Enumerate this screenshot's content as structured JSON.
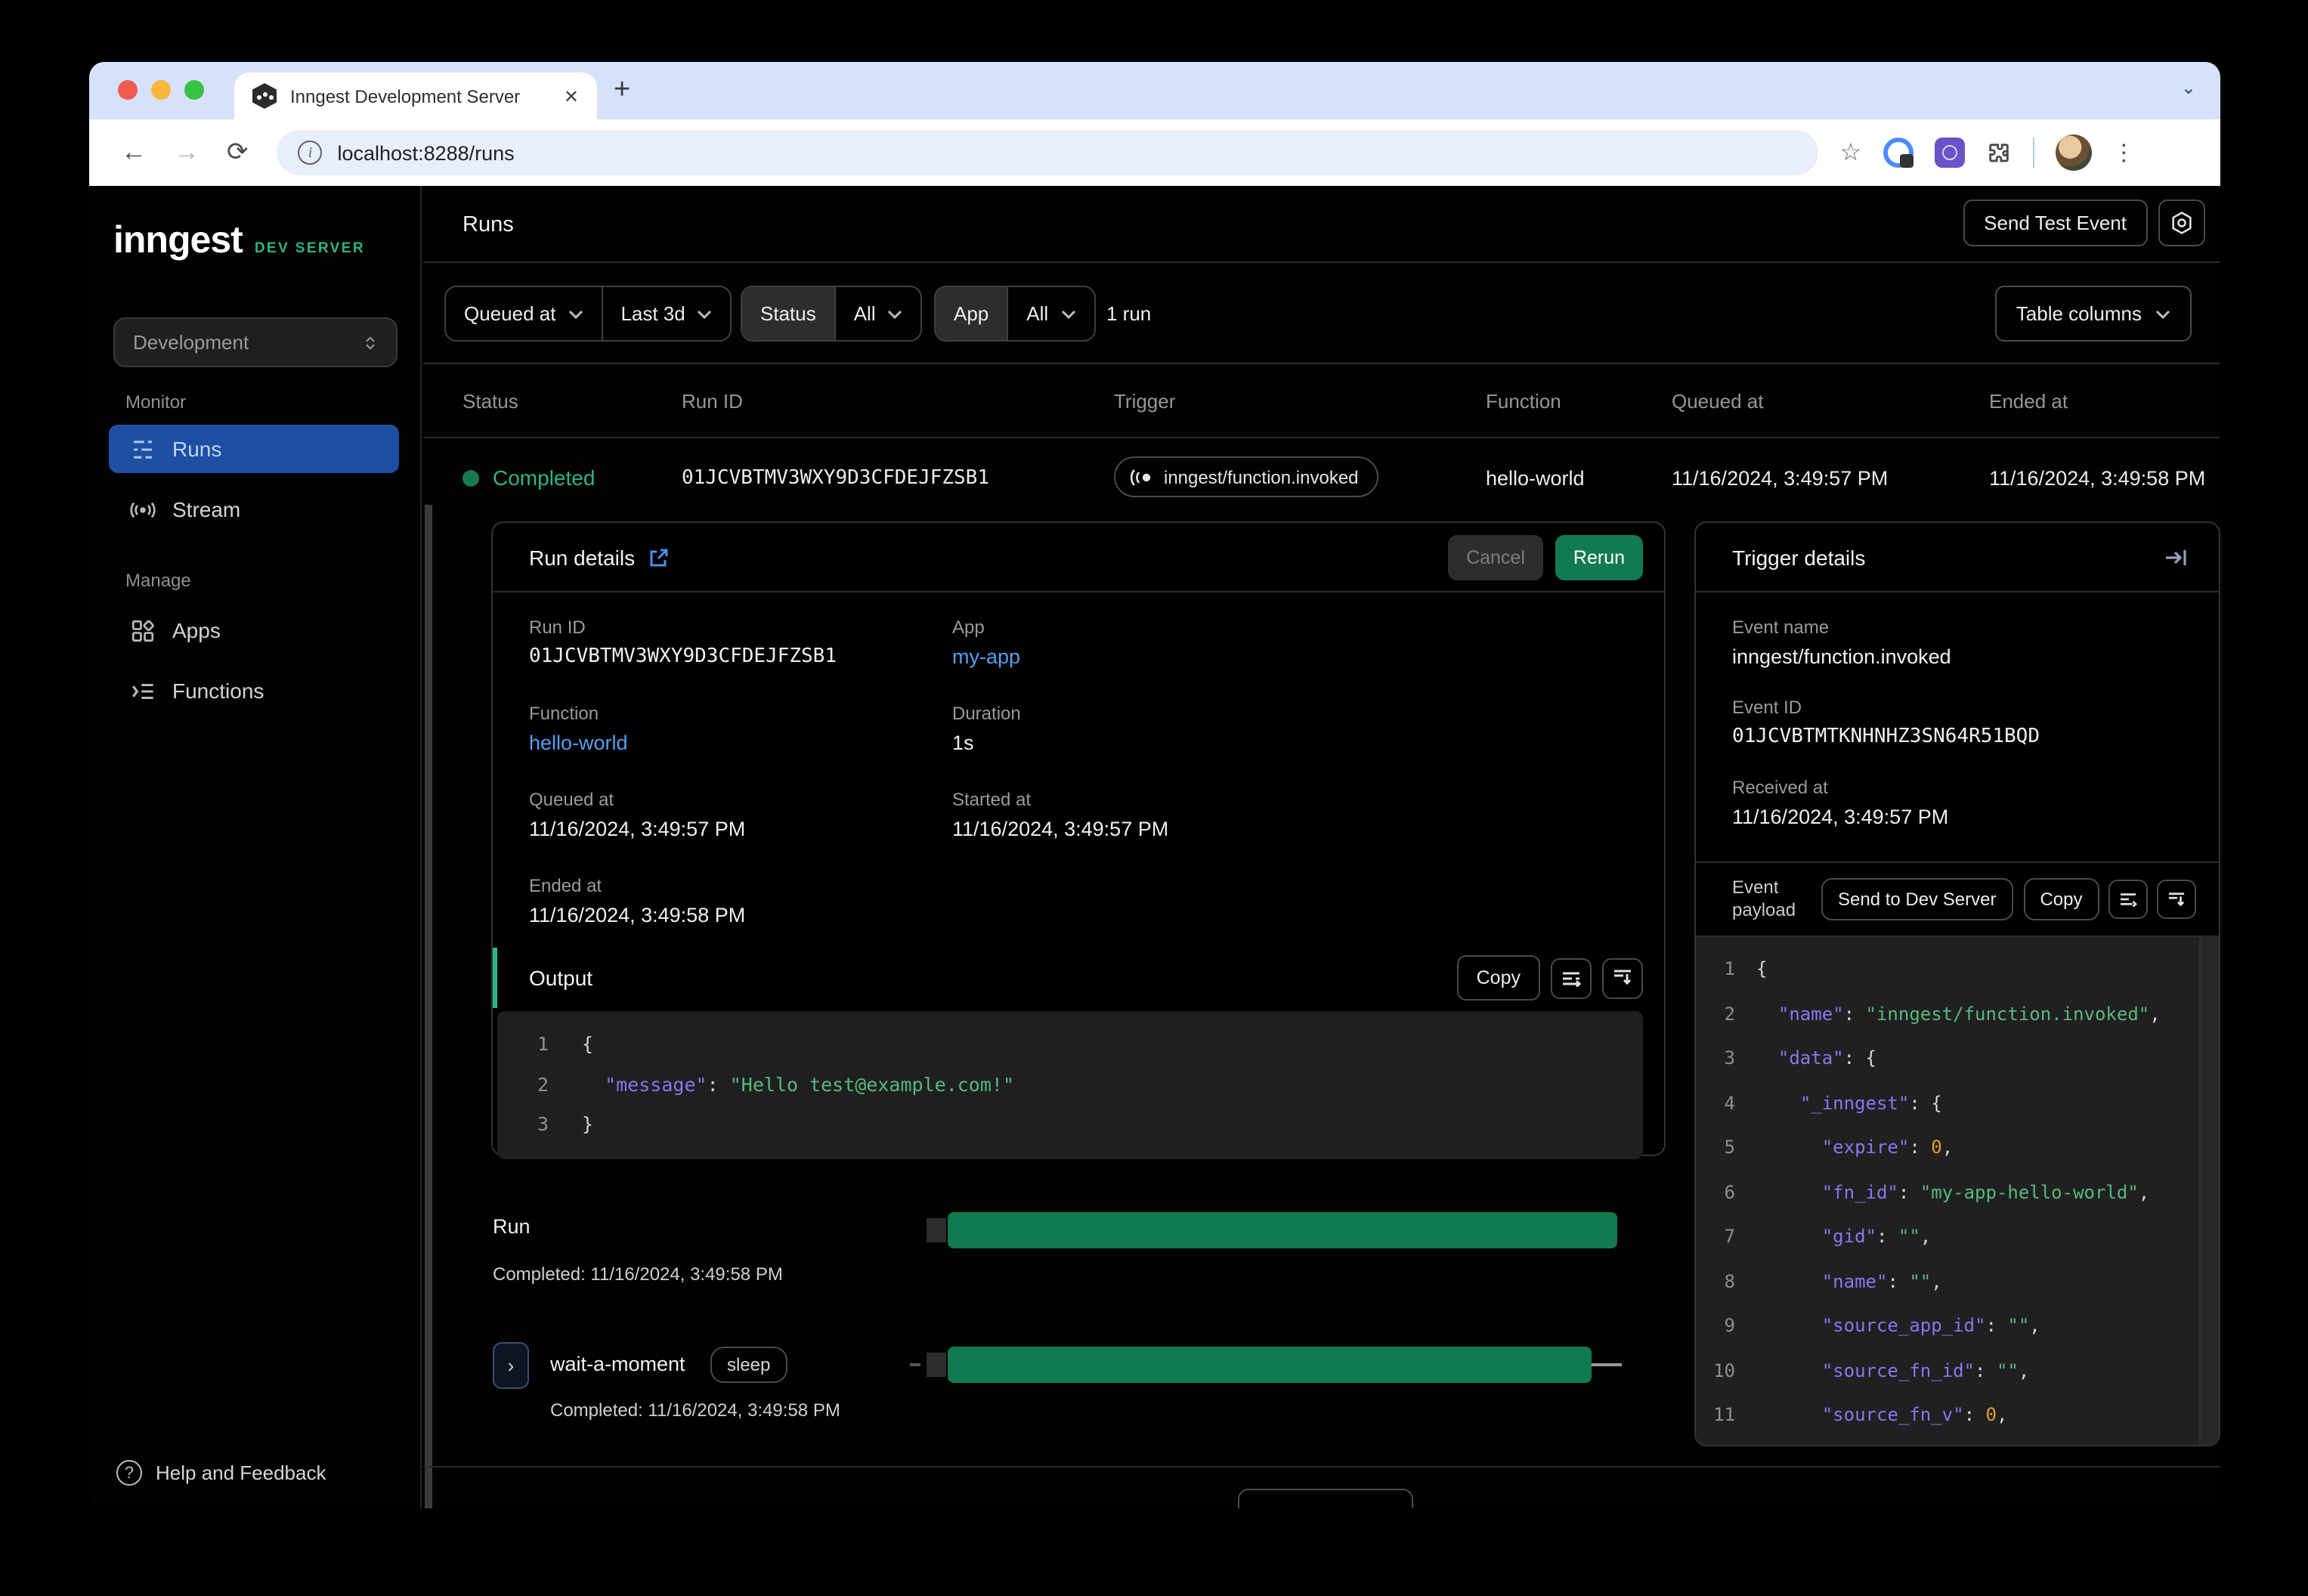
{
  "browser": {
    "tab_title": "Inngest Development Server",
    "close_tab": "✕",
    "new_tab": "+",
    "url": "localhost:8288/runs",
    "back": "←",
    "forward": "→",
    "reload": "⟳",
    "info": "i",
    "star": "☆",
    "kebab": "⋮",
    "strip_chevron": "⌄"
  },
  "sidebar": {
    "logo": "inngest",
    "env": "DEV SERVER",
    "workspace": "Development",
    "monitor_label": "Monitor",
    "manage_label": "Manage",
    "items": [
      {
        "label": "Runs"
      },
      {
        "label": "Stream"
      },
      {
        "label": "Apps"
      },
      {
        "label": "Functions"
      }
    ],
    "help": "Help and Feedback"
  },
  "header": {
    "title": "Runs",
    "send_test_event": "Send Test Event"
  },
  "filters": {
    "field": "Queued at",
    "range": "Last 3d",
    "status_label": "Status",
    "status_value": "All",
    "app_label": "App",
    "app_value": "All",
    "count": "1 run",
    "table_columns": "Table columns"
  },
  "table": {
    "columns": [
      "Status",
      "Run ID",
      "Trigger",
      "Function",
      "Queued at",
      "Ended at"
    ],
    "row": {
      "status": "Completed",
      "run_id": "01JCVBTMV3WXY9D3CFDEJFZSB1",
      "trigger": "inngest/function.invoked",
      "function": "hello-world",
      "queued_at": "11/16/2024, 3:49:57 PM",
      "ended_at": "11/16/2024, 3:49:58 PM"
    }
  },
  "run_details": {
    "title": "Run details",
    "cancel": "Cancel",
    "rerun": "Rerun",
    "fields": [
      {
        "label": "Run ID",
        "value": "01JCVBTMV3WXY9D3CFDEJFZSB1"
      },
      {
        "label": "App",
        "value": "my-app"
      },
      {
        "label": "Function",
        "value": "hello-world"
      },
      {
        "label": "Duration",
        "value": "1s"
      },
      {
        "label": "Queued at",
        "value": "11/16/2024, 3:49:57 PM"
      },
      {
        "label": "Started at",
        "value": "11/16/2024, 3:49:57 PM"
      },
      {
        "label": "Ended at",
        "value": "11/16/2024, 3:49:58 PM"
      }
    ],
    "output": {
      "title": "Output",
      "copy": "Copy",
      "lines": [
        {
          "n": "1",
          "tokens": [
            {
              "t": "p",
              "v": "{"
            }
          ]
        },
        {
          "n": "2",
          "tokens": [
            {
              "t": "p",
              "v": "  "
            },
            {
              "t": "k",
              "v": "\"message\""
            },
            {
              "t": "p",
              "v": ": "
            },
            {
              "t": "s",
              "v": "\"Hello test@example.com!\""
            }
          ]
        },
        {
          "n": "3",
          "tokens": [
            {
              "t": "p",
              "v": "}"
            }
          ]
        }
      ]
    }
  },
  "timeline": {
    "run_label": "Run",
    "run_completed": "Completed: 11/16/2024, 3:49:58 PM",
    "step_name": "wait-a-moment",
    "step_kind": "sleep",
    "step_completed": "Completed: 11/16/2024, 3:49:58 PM",
    "expand": "›"
  },
  "trigger_details": {
    "title": "Trigger details",
    "fields": [
      {
        "label": "Event name",
        "value": "inngest/function.invoked"
      },
      {
        "label": "Event ID",
        "value": "01JCVBTMTKNHNHZ3SN64R51BQD"
      },
      {
        "label": "Received at",
        "value": "11/16/2024, 3:49:57 PM"
      }
    ],
    "payload": {
      "label_line1": "Event",
      "label_line2": "payload",
      "send": "Send to Dev Server",
      "copy": "Copy",
      "lines": [
        {
          "n": "1",
          "tokens": [
            {
              "t": "p",
              "v": "{"
            }
          ]
        },
        {
          "n": "2",
          "tokens": [
            {
              "t": "p",
              "v": "  "
            },
            {
              "t": "k",
              "v": "\"name\""
            },
            {
              "t": "p",
              "v": ": "
            },
            {
              "t": "s",
              "v": "\"inngest/function.invoked\""
            },
            {
              "t": "p",
              "v": ","
            }
          ]
        },
        {
          "n": "3",
          "tokens": [
            {
              "t": "p",
              "v": "  "
            },
            {
              "t": "k",
              "v": "\"data\""
            },
            {
              "t": "p",
              "v": ": {"
            }
          ]
        },
        {
          "n": "4",
          "tokens": [
            {
              "t": "p",
              "v": "    "
            },
            {
              "t": "k",
              "v": "\"_inngest\""
            },
            {
              "t": "p",
              "v": ": {"
            }
          ]
        },
        {
          "n": "5",
          "tokens": [
            {
              "t": "p",
              "v": "      "
            },
            {
              "t": "k",
              "v": "\"expire\""
            },
            {
              "t": "p",
              "v": ": "
            },
            {
              "t": "n",
              "v": "0"
            },
            {
              "t": "p",
              "v": ","
            }
          ]
        },
        {
          "n": "6",
          "tokens": [
            {
              "t": "p",
              "v": "      "
            },
            {
              "t": "k",
              "v": "\"fn_id\""
            },
            {
              "t": "p",
              "v": ": "
            },
            {
              "t": "s",
              "v": "\"my-app-hello-world\""
            },
            {
              "t": "p",
              "v": ","
            }
          ]
        },
        {
          "n": "7",
          "tokens": [
            {
              "t": "p",
              "v": "      "
            },
            {
              "t": "k",
              "v": "\"gid\""
            },
            {
              "t": "p",
              "v": ": "
            },
            {
              "t": "s",
              "v": "\"\""
            },
            {
              "t": "p",
              "v": ","
            }
          ]
        },
        {
          "n": "8",
          "tokens": [
            {
              "t": "p",
              "v": "      "
            },
            {
              "t": "k",
              "v": "\"name\""
            },
            {
              "t": "p",
              "v": ": "
            },
            {
              "t": "s",
              "v": "\"\""
            },
            {
              "t": "p",
              "v": ","
            }
          ]
        },
        {
          "n": "9",
          "tokens": [
            {
              "t": "p",
              "v": "      "
            },
            {
              "t": "k",
              "v": "\"source_app_id\""
            },
            {
              "t": "p",
              "v": ": "
            },
            {
              "t": "s",
              "v": "\"\""
            },
            {
              "t": "p",
              "v": ","
            }
          ]
        },
        {
          "n": "10",
          "tokens": [
            {
              "t": "p",
              "v": "      "
            },
            {
              "t": "k",
              "v": "\"source_fn_id\""
            },
            {
              "t": "p",
              "v": ": "
            },
            {
              "t": "s",
              "v": "\"\""
            },
            {
              "t": "p",
              "v": ","
            }
          ]
        },
        {
          "n": "11",
          "tokens": [
            {
              "t": "p",
              "v": "      "
            },
            {
              "t": "k",
              "v": "\"source_fn_v\""
            },
            {
              "t": "p",
              "v": ": "
            },
            {
              "t": "n",
              "v": "0"
            },
            {
              "t": "p",
              "v": ","
            }
          ]
        }
      ]
    }
  },
  "colors": {
    "accent_green": "#2eb483",
    "bar_green": "#0f7a50",
    "active_blue": "#1e4fa3",
    "link_blue": "#54a0f0",
    "code_key": "#8b74f0",
    "code_string": "#57b97f",
    "code_number": "#e09f26"
  }
}
